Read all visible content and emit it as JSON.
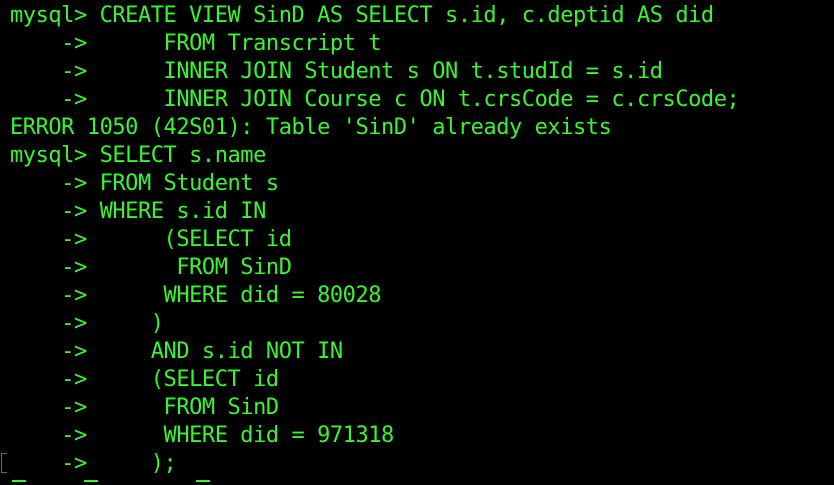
{
  "terminal": {
    "text_color": "#39f52f",
    "background": "#000000",
    "lines": [
      "mysql> CREATE VIEW SinD AS SELECT s.id, c.deptid AS did",
      "    ->      FROM Transcript t",
      "    ->      INNER JOIN Student s ON t.studId = s.id",
      "    ->      INNER JOIN Course c ON t.crsCode = c.crsCode;",
      "ERROR 1050 (42S01): Table 'SinD' already exists",
      "mysql> SELECT s.name",
      "    -> FROM Student s",
      "    -> WHERE s.id IN",
      "    ->      (SELECT id",
      "    ->       FROM SinD",
      "    ->      WHERE did = 80028",
      "    ->     )",
      "    ->     AND s.id NOT IN",
      "    ->     (SELECT id",
      "    ->      FROM SinD",
      "    ->      WHERE did = 971318",
      "    ->     );"
    ]
  }
}
